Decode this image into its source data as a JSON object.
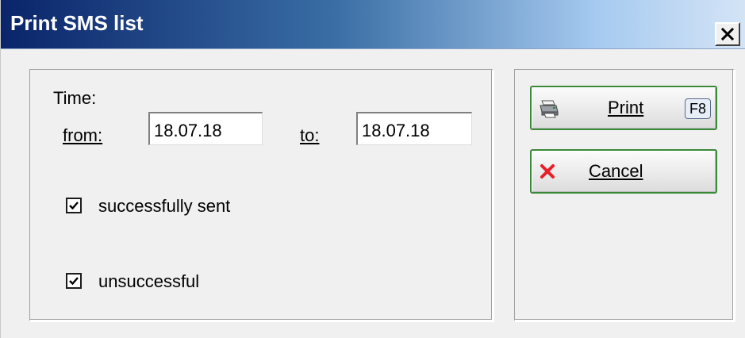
{
  "window": {
    "title": "Print SMS list"
  },
  "form": {
    "time_label": "Time:",
    "from_label": "from:",
    "from_value": "18.07.18",
    "to_label": "to:",
    "to_value": "18.07.18",
    "options": [
      {
        "label": "successfully sent",
        "checked": true
      },
      {
        "label": "unsuccessful",
        "checked": true
      }
    ]
  },
  "buttons": {
    "print": {
      "label": "Print",
      "shortcut": "F8",
      "icon": "printer-icon"
    },
    "cancel": {
      "label": "Cancel",
      "icon": "red-x-icon"
    }
  },
  "colors": {
    "title_gradient_start": "#0a246a",
    "title_gradient_end": "#a6caf0",
    "button_border": "#3a8a3a",
    "cancel_icon": "#e8202a"
  }
}
